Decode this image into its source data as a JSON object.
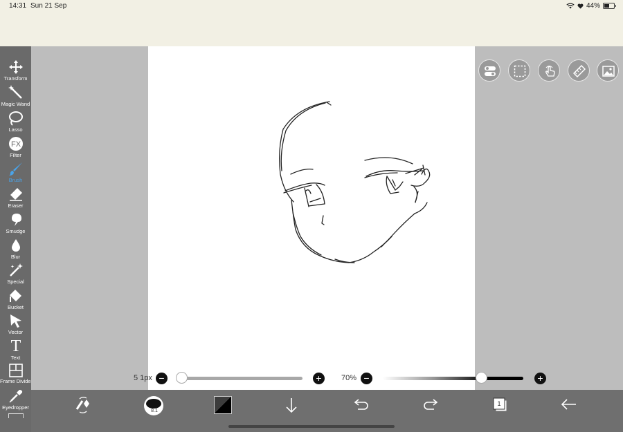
{
  "status_bar": {
    "time": "14:31",
    "date": "Sun 21 Sep",
    "battery": "44%"
  },
  "toolbar": {
    "tools": [
      {
        "label": "Transform",
        "icon": "move-arrows-icon"
      },
      {
        "label": "Magic Wand",
        "icon": "magic-wand-icon"
      },
      {
        "label": "Lasso",
        "icon": "lasso-icon"
      },
      {
        "label": "Filter",
        "icon": "fx-icon",
        "glyph": "FX"
      },
      {
        "label": "Brush",
        "icon": "brush-icon",
        "active": true
      },
      {
        "label": "Eraser",
        "icon": "eraser-icon"
      },
      {
        "label": "Smudge",
        "icon": "smudge-icon"
      },
      {
        "label": "Blur",
        "icon": "droplet-icon"
      },
      {
        "label": "Special",
        "icon": "sparkle-pen-icon"
      },
      {
        "label": "Bucket",
        "icon": "bucket-icon"
      },
      {
        "label": "Vector",
        "icon": "cursor-arrow-icon"
      },
      {
        "label": "Text",
        "icon": "text-icon",
        "glyph": "T"
      },
      {
        "label": "Frame Divider",
        "icon": "frame-divider-icon"
      },
      {
        "label": "Eyedropper",
        "icon": "eyedropper-icon"
      }
    ],
    "active_color": "#4aa3e8"
  },
  "quick_actions": [
    {
      "name": "toggle-icon"
    },
    {
      "name": "selection-icon"
    },
    {
      "name": "hand-touch-icon"
    },
    {
      "name": "ruler-icon"
    },
    {
      "name": "image-icon"
    }
  ],
  "brush_controls": {
    "size_label": "5 1px",
    "size_fraction": 0.0,
    "opacity_label": "70%",
    "opacity_fraction": 0.7
  },
  "bottom_bar": {
    "items": [
      {
        "name": "swap-tool-icon"
      },
      {
        "name": "brush-preview-icon",
        "text": "8.1"
      },
      {
        "name": "color-swatch",
        "color": "#111111"
      },
      {
        "name": "download-arrow-icon"
      },
      {
        "name": "undo-icon"
      },
      {
        "name": "redo-icon"
      },
      {
        "name": "layers-icon",
        "text": "1"
      },
      {
        "name": "back-arrow-icon"
      }
    ]
  }
}
